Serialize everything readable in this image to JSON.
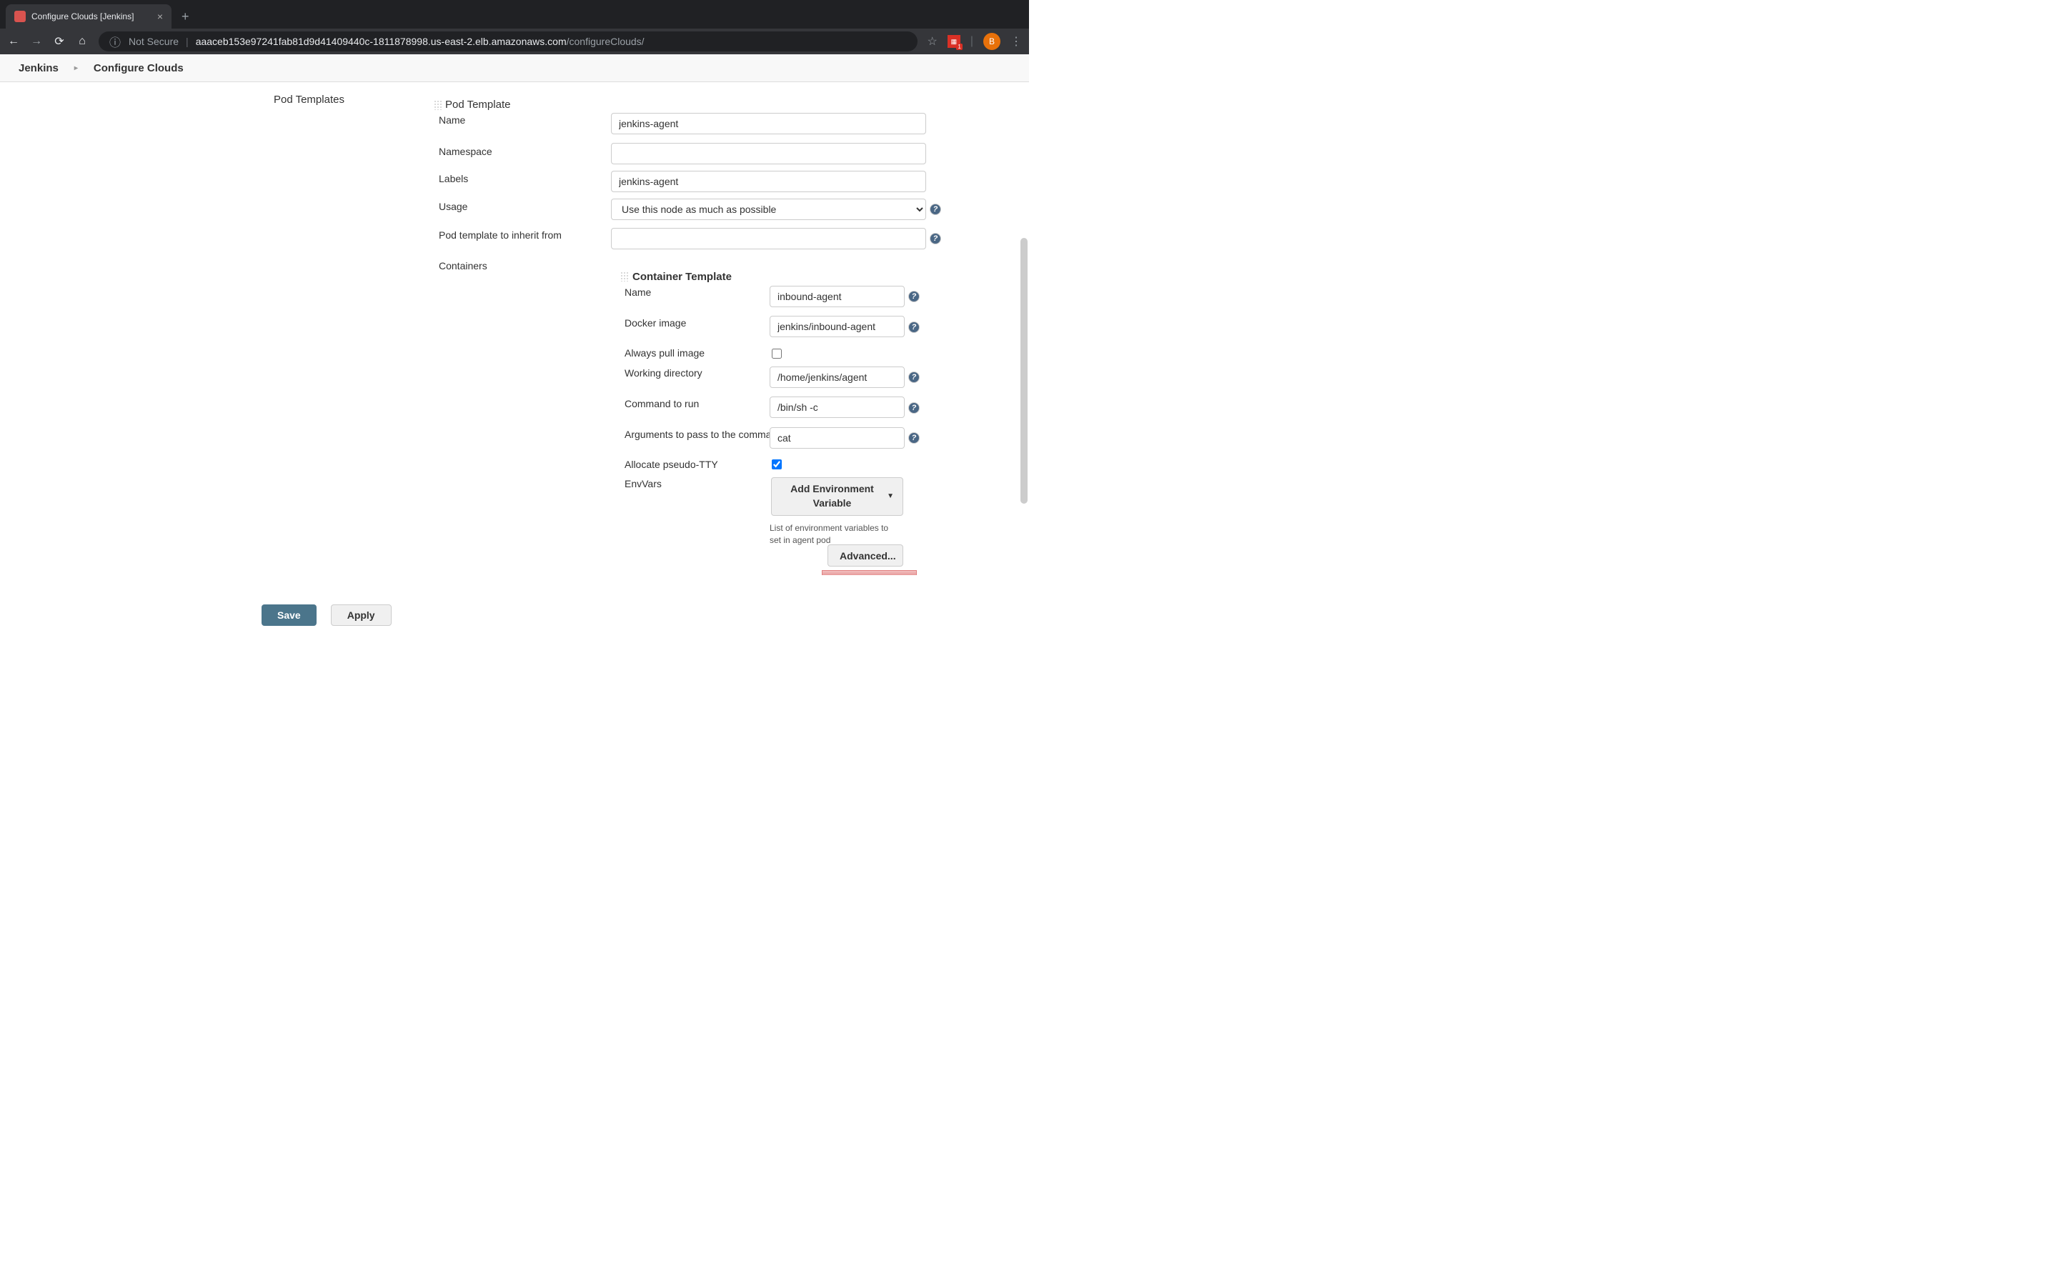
{
  "browser": {
    "tab_title": "Configure Clouds [Jenkins]",
    "not_secure": "Not Secure",
    "url_host": "aaaceb153e97241fab81d9d41409440c-1811878998.us-east-2.elb.amazonaws.com",
    "url_path": "/configureClouds/",
    "profile_letter": "B",
    "ext_badge": "1"
  },
  "breadcrumb": {
    "root": "Jenkins",
    "page": "Configure Clouds"
  },
  "sections": {
    "pod_templates": "Pod Templates",
    "pod_template": "Pod Template",
    "container_template": "Container Template",
    "containers": "Containers"
  },
  "pod": {
    "name_label": "Name",
    "name_value": "jenkins-agent",
    "namespace_label": "Namespace",
    "namespace_value": "",
    "labels_label": "Labels",
    "labels_value": "jenkins-agent",
    "usage_label": "Usage",
    "usage_value": "Use this node as much as possible",
    "inherit_label": "Pod template to inherit from",
    "inherit_value": ""
  },
  "container": {
    "name_label": "Name",
    "name_value": "inbound-agent",
    "docker_label": "Docker image",
    "docker_value": "jenkins/inbound-agent",
    "pull_label": "Always pull image",
    "pull_checked": false,
    "workdir_label": "Working directory",
    "workdir_value": "/home/jenkins/agent",
    "command_label": "Command to run",
    "command_value": "/bin/sh -c",
    "args_label": "Arguments to pass to the command",
    "args_value": "cat",
    "tty_label": "Allocate pseudo-TTY",
    "tty_checked": true,
    "envvars_label": "EnvVars",
    "add_env_button": "Add Environment Variable",
    "env_hint": "List of environment variables to set in agent pod",
    "advanced_button": "Advanced..."
  },
  "footer": {
    "save": "Save",
    "apply": "Apply"
  }
}
